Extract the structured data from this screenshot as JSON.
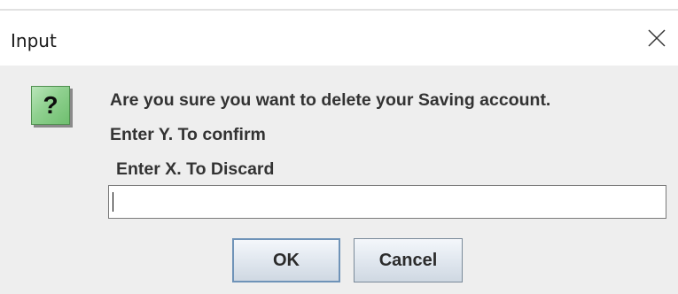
{
  "dialog": {
    "title": "Input",
    "close_icon": "close-icon",
    "icon": {
      "name": "question-icon",
      "glyph": "?",
      "color": "#8fd08f"
    },
    "message": {
      "line1": "Are you sure you want to delete your Saving account.",
      "line2": "Enter Y. To confirm",
      "line3": "Enter X. To Discard"
    },
    "input": {
      "value": "",
      "placeholder": ""
    },
    "buttons": {
      "ok_label": "OK",
      "cancel_label": "Cancel"
    }
  }
}
